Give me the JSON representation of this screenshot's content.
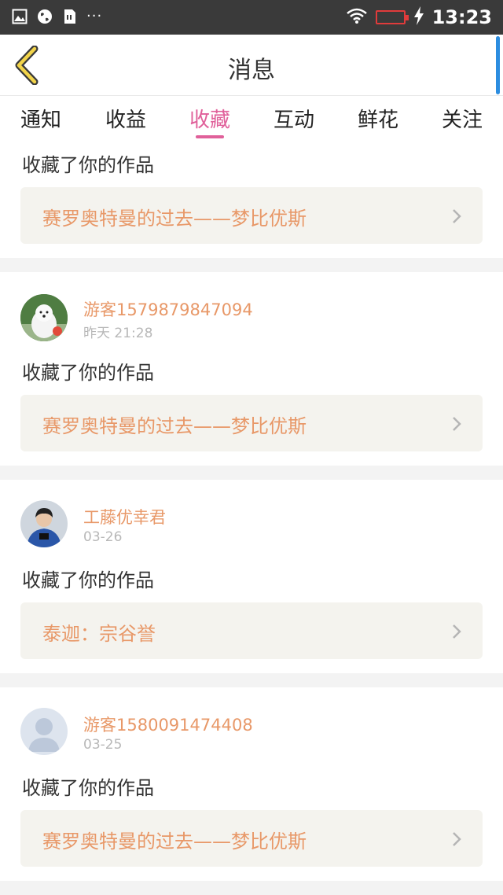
{
  "status_bar": {
    "left_icons": [
      "image-icon",
      "globe-icon",
      "sim-icon"
    ],
    "dots": "···",
    "time": "13:23"
  },
  "header": {
    "title": "消息"
  },
  "tabs": [
    {
      "label": "通知",
      "active": false
    },
    {
      "label": "收益",
      "active": false
    },
    {
      "label": "收藏",
      "active": true
    },
    {
      "label": "互动",
      "active": false
    },
    {
      "label": "鲜花",
      "active": false
    },
    {
      "label": "关注",
      "active": false
    }
  ],
  "messages": [
    {
      "user": "",
      "time": "",
      "action": "收藏了你的作品",
      "work": "赛罗奥特曼的过去——梦比优斯"
    },
    {
      "user": "游客1579879847094",
      "time": "昨天 21:28",
      "action": "收藏了你的作品",
      "work": "赛罗奥特曼的过去——梦比优斯"
    },
    {
      "user": "工藤优幸君",
      "time": "03-26",
      "action": "收藏了你的作品",
      "work": "泰迦：宗谷誉"
    },
    {
      "user": "游客1580091474408",
      "time": "03-25",
      "action": "收藏了你的作品",
      "work": "赛罗奥特曼的过去——梦比优斯"
    }
  ],
  "colors": {
    "accent": "#e0609a",
    "name": "#e89868",
    "status_bar": "#3a3a3a"
  }
}
